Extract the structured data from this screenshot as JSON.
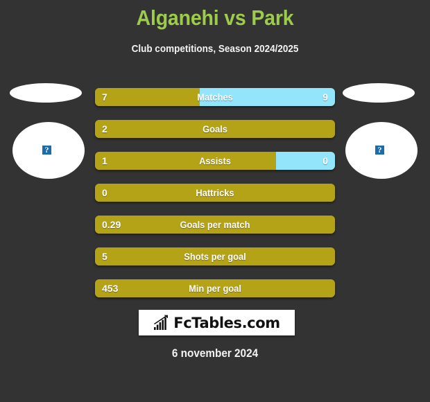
{
  "header": {
    "title": "Alganehi vs Park",
    "subtitle": "Club competitions, Season 2024/2025",
    "title_color": "#9ccc4a"
  },
  "players": {
    "home": {
      "photo_state": "broken-image",
      "broken_glyph": "?"
    },
    "away": {
      "photo_state": "broken-image",
      "broken_glyph": "?"
    }
  },
  "colors": {
    "background": "#333333",
    "home_bar": "#b5a317",
    "away_bar": "#92e5fb",
    "title_green": "#9ccc4a",
    "text": "#ffffff"
  },
  "chart_data": {
    "type": "bar",
    "title": "Alganehi vs Park",
    "subtitle": "Club competitions, Season 2024/2025",
    "orientation": "horizontal-diverging",
    "categories": [
      "Matches",
      "Goals",
      "Assists",
      "Hattricks",
      "Goals per match",
      "Shots per goal",
      "Min per goal"
    ],
    "series": [
      {
        "name": "Alganehi",
        "color": "#b5a317",
        "values": [
          "7",
          "2",
          "1",
          "0",
          "0.29",
          "5",
          "453"
        ]
      },
      {
        "name": "Park",
        "color": "#92e5fb",
        "values": [
          "9",
          "",
          "0",
          "",
          "",
          "",
          ""
        ]
      }
    ],
    "rows": [
      {
        "label": "Matches",
        "home": "7",
        "away": "9",
        "home_pct": 43.5,
        "has_away": true
      },
      {
        "label": "Goals",
        "home": "2",
        "away": "",
        "home_pct": 100,
        "has_away": false
      },
      {
        "label": "Assists",
        "home": "1",
        "away": "0",
        "home_pct": 75.5,
        "has_away": true
      },
      {
        "label": "Hattricks",
        "home": "0",
        "away": "",
        "home_pct": 100,
        "has_away": false
      },
      {
        "label": "Goals per match",
        "home": "0.29",
        "away": "",
        "home_pct": 100,
        "has_away": false
      },
      {
        "label": "Shots per goal",
        "home": "5",
        "away": "",
        "home_pct": 100,
        "has_away": false
      },
      {
        "label": "Min per goal",
        "home": "453",
        "away": "",
        "home_pct": 100,
        "has_away": false
      }
    ],
    "legend": [
      "Alganehi",
      "Park"
    ],
    "grid": false
  },
  "footer": {
    "logo_text": "FcTables.com",
    "logo_icon": "bar-chart-arrow-icon",
    "date": "6 november 2024"
  }
}
